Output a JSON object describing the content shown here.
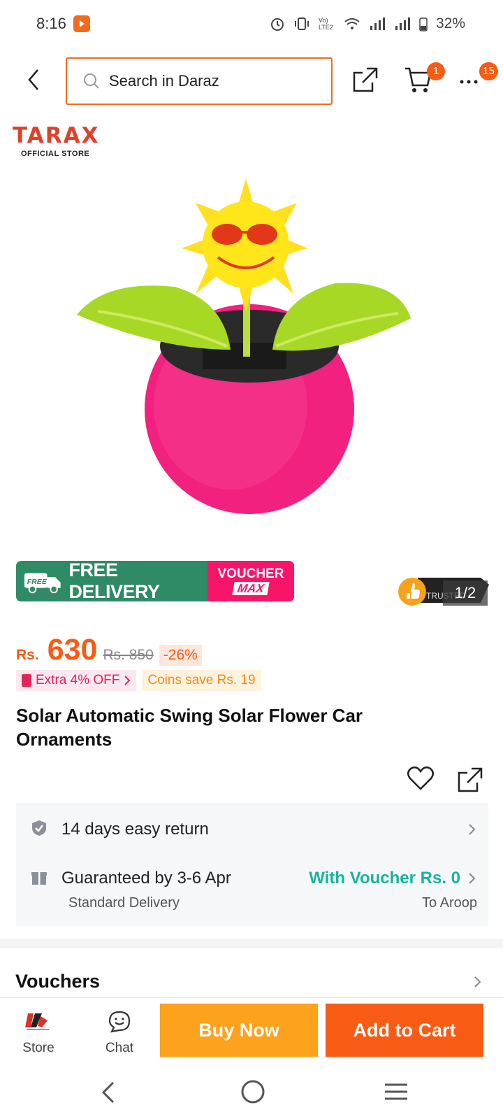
{
  "status_bar": {
    "time": "8:16",
    "network_label": "Vo) LTE2",
    "battery": "32%"
  },
  "header": {
    "search_placeholder": "Search in Daraz",
    "cart_count": "1",
    "more_count": "15"
  },
  "store": {
    "brand": "TARAX",
    "subtitle": "OFFICIAL STORE"
  },
  "promo": {
    "free_label": "FREE",
    "free_delivery": "FREE DELIVERY",
    "voucher": "VOUCHER",
    "voucher_max": "MAX"
  },
  "gallery": {
    "pager": "1/2",
    "trust_label": "TRUSTED"
  },
  "price": {
    "currency": "Rs.",
    "value": "630",
    "original": "Rs. 850",
    "discount": "-26%"
  },
  "offers": {
    "extra_off": "Extra 4% OFF",
    "coins": "Coins save Rs. 19"
  },
  "product": {
    "title": "Solar Automatic Swing Solar Flower Car Ornaments"
  },
  "service": {
    "return_label": "14 days easy return",
    "delivery_label": "Guaranteed by 3-6 Apr",
    "delivery_sub": "Standard Delivery",
    "voucher_label": "With Voucher Rs. 0",
    "location": "To Aroop"
  },
  "sections": {
    "vouchers": "Vouchers"
  },
  "action_bar": {
    "store_label": "Store",
    "chat_label": "Chat",
    "buy_now": "Buy Now",
    "add_to_cart": "Add to Cart"
  },
  "colors": {
    "brand_orange": "#f75b14",
    "buy_now": "#fca21d",
    "free_delivery_green": "#2f8a66",
    "voucher_pink": "#f7156a",
    "voucher_teal": "#16b49c"
  },
  "icons": [
    "back-icon",
    "search-icon",
    "share-icon",
    "cart-icon",
    "more-icon",
    "heart-icon",
    "shield-check-icon",
    "gift-icon",
    "chevron-right-icon",
    "chat-icon",
    "store-logo-icon"
  ]
}
